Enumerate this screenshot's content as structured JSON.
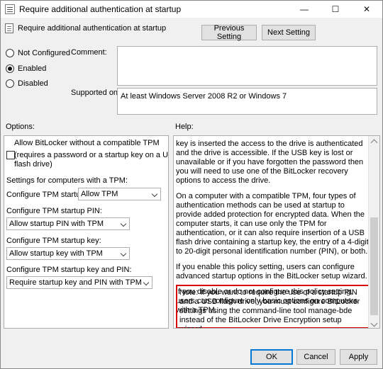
{
  "window": {
    "title": "Require additional authentication at startup",
    "minimize": "—",
    "maximize": "☐",
    "close": "✕"
  },
  "header": {
    "title": "Require additional authentication at startup"
  },
  "nav": {
    "previous_label": "Previous Setting",
    "next_label": "Next Setting"
  },
  "state": {
    "options": [
      {
        "label": "Not Configured",
        "checked": false
      },
      {
        "label": "Enabled",
        "checked": true
      },
      {
        "label": "Disabled",
        "checked": false
      }
    ]
  },
  "fields": {
    "comment_label": "Comment:",
    "comment_value": "",
    "supported_label": "Supported on:",
    "supported_value": "At least Windows Server 2008 R2 or Windows 7"
  },
  "sections": {
    "options_label": "Options:",
    "help_label": "Help:"
  },
  "options": {
    "allow_title": "Allow BitLocker without a compatible TPM",
    "allow_checkbox_label_1": "(requires a password or a startup key on a USB",
    "allow_checkbox_label_2": "flash drive)",
    "settings_heading": "Settings for computers with a TPM:",
    "tpm_startup_label": "Configure TPM startup:",
    "tpm_startup_value": "Allow TPM",
    "tpm_pin_label": "Configure TPM startup PIN:",
    "tpm_pin_value": "Allow startup PIN with TPM",
    "tpm_key_label": "Configure TPM startup key:",
    "tpm_key_value": "Allow startup key with TPM",
    "tpm_key_pin_label": "Configure TPM startup key and PIN:",
    "tpm_key_pin_value": "Require startup key and PIN with TPM"
  },
  "help": {
    "p1": "key is inserted the access to the drive is authenticated and the drive is accessible. If the USB key is lost or unavailable or if you have forgotten the password then you will need to use one of the BitLocker recovery options to access the drive.",
    "p2": "On a computer with a compatible TPM, four types of authentication methods can be used at startup to provide added protection for encrypted data. When the computer starts, it can use only the TPM for authentication, or it can also require insertion of a USB flash drive containing a startup key, the entry of a 4-digit to 20-digit personal identification number (PIN), or both.",
    "p3": "If you enable this policy setting, users can configure advanced startup options in the BitLocker setup wizard.",
    "p4": "If you disable or do not configure this policy setting, users can configure only basic options on computers with a TPM.",
    "p5": "Note: If you want to require the use of a startup PIN and a USB flash drive, you must configure BitLocker settings using the command-line tool manage-bde instead of the BitLocker Drive Encryption setup wizard."
  },
  "buttons": {
    "ok": "OK",
    "cancel": "Cancel",
    "apply": "Apply"
  },
  "colors": {
    "highlight_border": "#d90000"
  }
}
